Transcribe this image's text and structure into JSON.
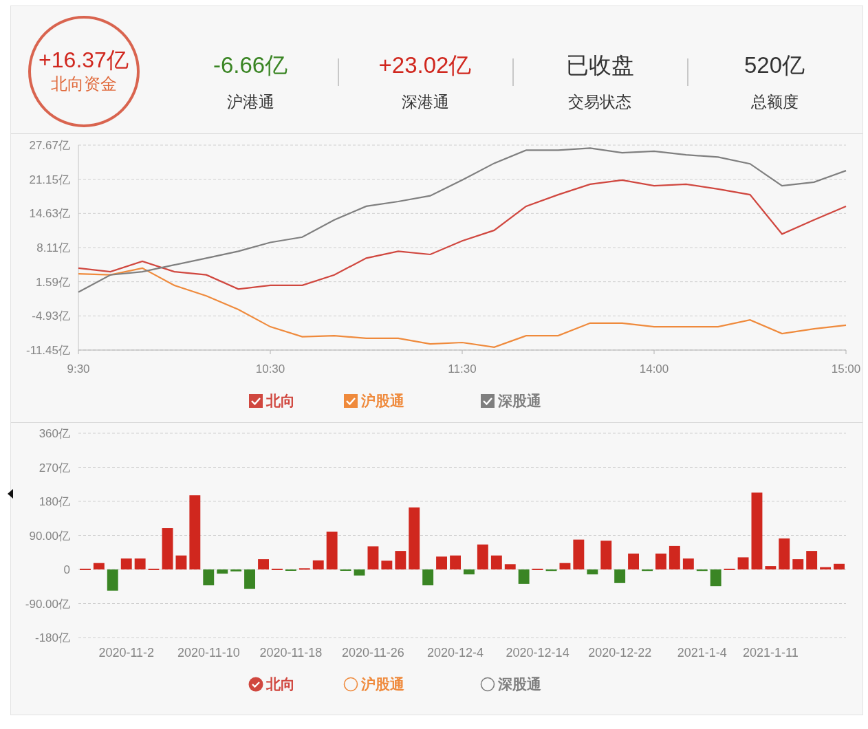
{
  "summary": {
    "value": "+16.37亿",
    "label": "北向资金"
  },
  "stats": [
    {
      "value": "-6.66亿",
      "label": "沪港通",
      "color": "#3a8524"
    },
    {
      "value": "+23.02亿",
      "label": "深港通",
      "color": "#d0271e"
    },
    {
      "value": "已收盘",
      "label": "交易状态",
      "color": "#333333"
    },
    {
      "value": "520亿",
      "label": "总额度",
      "color": "#333333"
    }
  ],
  "intraday": {
    "chart_data": {
      "type": "line",
      "categories": [
        "9:30",
        null,
        null,
        null,
        null,
        null,
        "10:30",
        null,
        null,
        null,
        null,
        null,
        "11:30",
        null,
        null,
        null,
        null,
        null,
        "14:00",
        null,
        null,
        null,
        null,
        null,
        "15:00"
      ],
      "yticks": [
        {
          "value": 27.67,
          "label": "27.67亿"
        },
        {
          "value": 21.15,
          "label": "21.15亿"
        },
        {
          "value": 14.63,
          "label": "14.63亿"
        },
        {
          "value": 8.11,
          "label": "8.11亿"
        },
        {
          "value": 1.59,
          "label": "1.59亿"
        },
        {
          "value": -4.93,
          "label": "-4.93亿"
        },
        {
          "value": -11.45,
          "label": "-11.45亿"
        }
      ],
      "ylim": [
        -11.45,
        27.67
      ],
      "grid": true,
      "series": [
        {
          "name": "北向",
          "color": "#d0473f",
          "values": [
            4.2,
            3.5,
            5.5,
            3.5,
            2.9,
            0.2,
            0.9,
            0.9,
            2.9,
            6.1,
            7.4,
            6.8,
            9.4,
            11.4,
            16,
            18.2,
            20.2,
            21,
            19.9,
            20.2,
            19.3,
            18.2,
            10.7,
            13.4,
            16
          ]
        },
        {
          "name": "沪股通",
          "color": "#ef8a3c",
          "values": [
            3.1,
            2.9,
            4.2,
            0.9,
            -1.1,
            -3.7,
            -7,
            -8.9,
            -8.7,
            -9.2,
            -9.2,
            -10.3,
            -10,
            -10.9,
            -8.7,
            -8.7,
            -6.3,
            -6.3,
            -7,
            -7,
            -7,
            -5.7,
            -8.3,
            -7.4,
            -6.7
          ]
        },
        {
          "name": "深股通",
          "color": "#7f7f7f",
          "values": [
            -0.4,
            2.9,
            3.5,
            4.8,
            6.1,
            7.4,
            9.1,
            10.1,
            13.4,
            16,
            16.9,
            18,
            21,
            24.2,
            26.7,
            26.7,
            27.1,
            26.2,
            26.5,
            25.8,
            25.4,
            24.1,
            19.9,
            20.6,
            22.8
          ]
        }
      ]
    }
  },
  "intraday_legend": [
    {
      "checked": true
    },
    {
      "checked": true
    },
    {
      "checked": true
    }
  ],
  "daily": {
    "chart_data": {
      "type": "bar",
      "categories": [
        null,
        null,
        null,
        "2020-11-2",
        null,
        null,
        null,
        null,
        null,
        "2020-11-10",
        null,
        null,
        null,
        null,
        null,
        "2020-11-18",
        null,
        null,
        null,
        null,
        null,
        "2020-11-26",
        null,
        null,
        null,
        null,
        null,
        "2020-12-4",
        null,
        null,
        null,
        null,
        null,
        "2020-12-14",
        null,
        null,
        null,
        null,
        null,
        "2020-12-22",
        null,
        null,
        null,
        null,
        null,
        "2021-1-4",
        null,
        null,
        null,
        null,
        "2021-1-11",
        null,
        null,
        null,
        null,
        null
      ],
      "yticks": [
        {
          "value": 360,
          "label": "360亿"
        },
        {
          "value": 270,
          "label": "270亿"
        },
        {
          "value": 180,
          "label": "180亿"
        },
        {
          "value": 90,
          "label": "90.00亿"
        },
        {
          "value": 0,
          "label": "0"
        },
        {
          "value": -90,
          "label": "-90.00亿"
        },
        {
          "value": -180,
          "label": "-180亿"
        }
      ],
      "ylim": [
        -180,
        360
      ],
      "grid": true,
      "stacked": true,
      "series": [
        {
          "color": "#d0271e",
          "values": [
            2,
            17,
            null,
            29,
            29,
            2,
            109,
            37,
            196,
            null,
            null,
            null,
            null,
            27,
            2,
            null,
            3,
            24,
            100,
            null,
            null,
            61,
            23,
            49,
            164,
            null,
            34,
            37,
            null,
            66,
            37,
            14,
            null,
            2,
            null,
            17,
            79,
            null,
            76,
            null,
            42,
            null,
            42,
            62,
            29,
            null,
            null,
            2,
            32,
            203,
            9,
            82,
            27,
            49,
            6,
            15
          ]
        },
        {
          "color": "#3a8524",
          "values": [
            null,
            null,
            -56,
            null,
            null,
            null,
            null,
            null,
            null,
            -42,
            -11,
            -5,
            -51,
            null,
            null,
            -2,
            null,
            null,
            null,
            -2,
            -16,
            null,
            null,
            null,
            null,
            -42,
            null,
            null,
            -13,
            null,
            null,
            null,
            -38,
            null,
            -4,
            null,
            null,
            -13,
            null,
            -36,
            null,
            -4,
            null,
            null,
            null,
            -4,
            -44,
            null,
            null,
            null,
            null,
            null,
            null,
            null,
            null,
            null
          ]
        }
      ]
    }
  },
  "daily_legend": [
    {
      "label": "北向",
      "color": "#d0473f",
      "selected": true
    },
    {
      "label": "沪股通",
      "color": "#ef8a3c",
      "selected": false
    },
    {
      "label": "深股通",
      "color": "#7f7f7f",
      "selected": false
    }
  ]
}
